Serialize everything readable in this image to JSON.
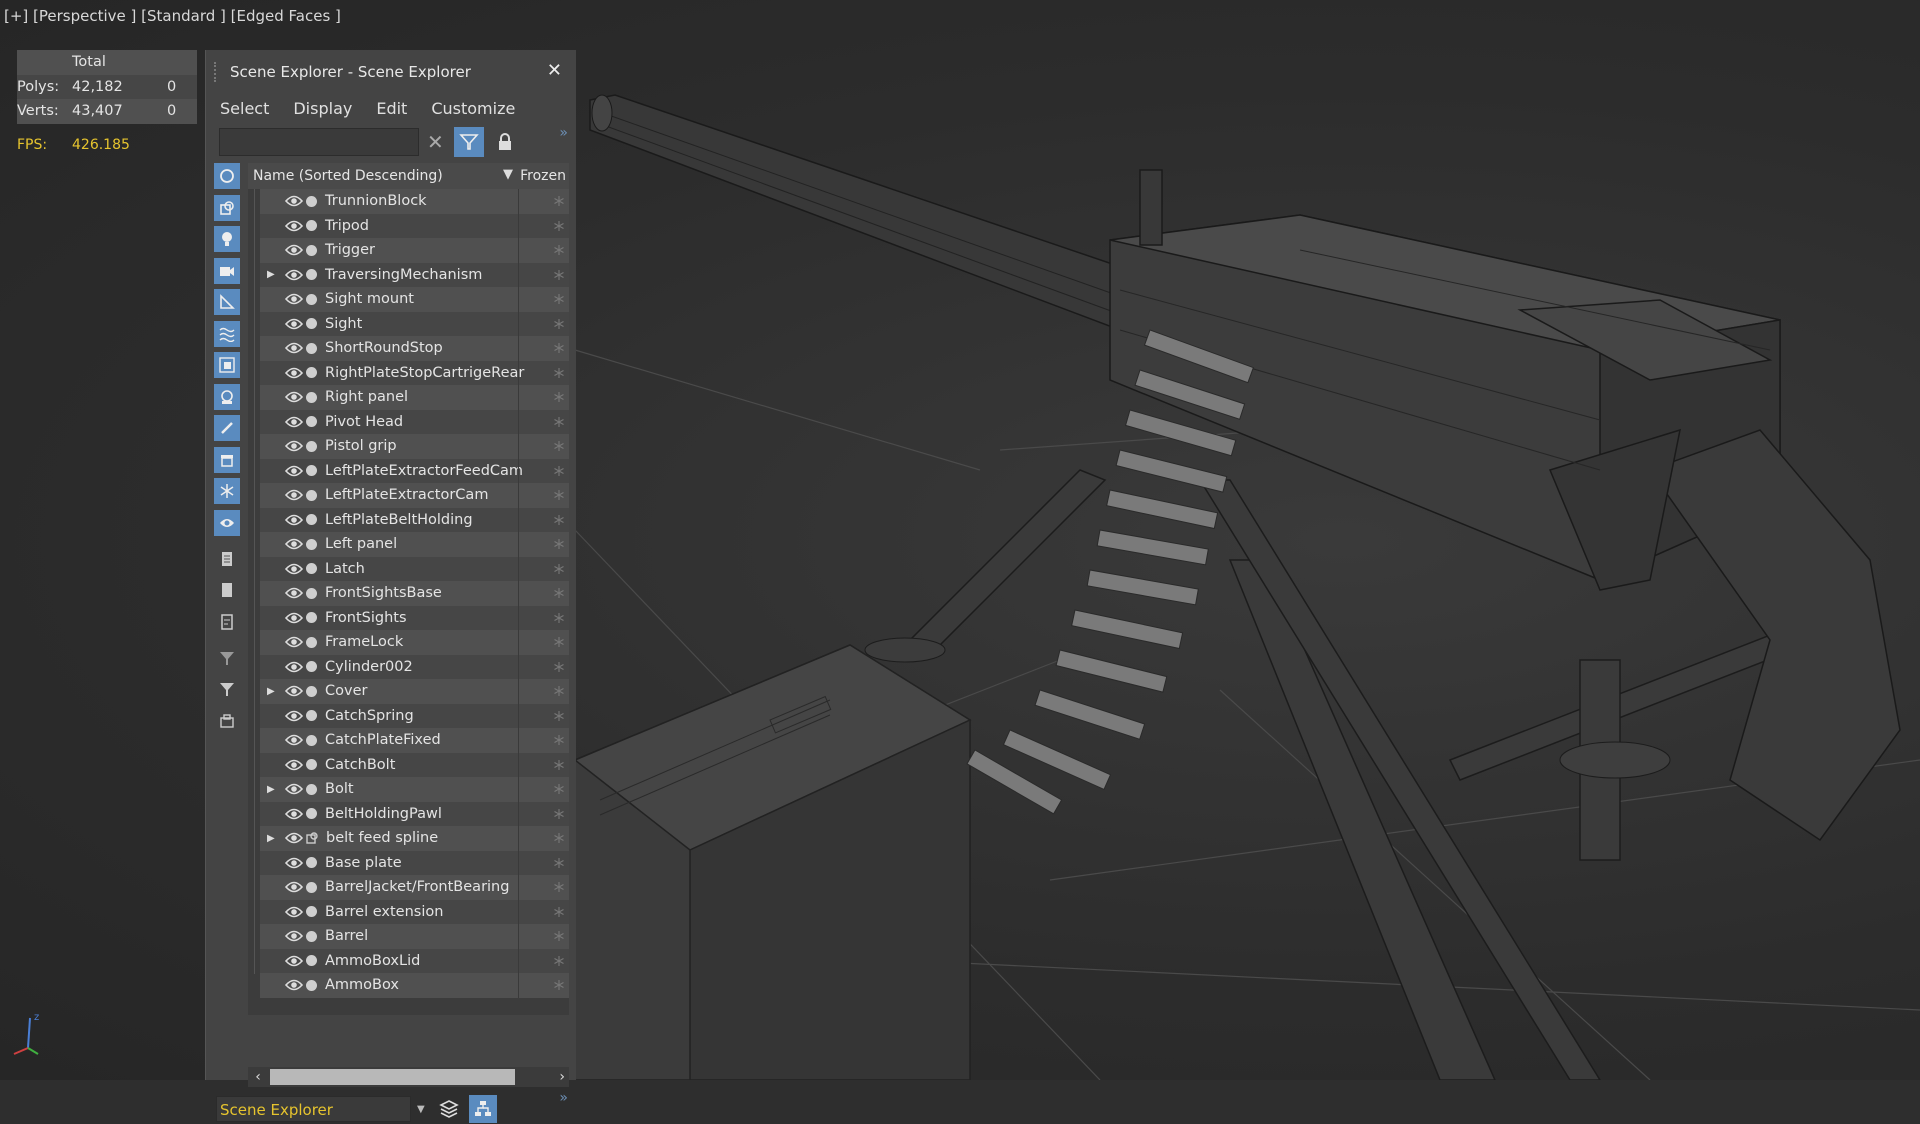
{
  "viewport": {
    "label": "[+] [Perspective ] [Standard ] [Edged Faces ]",
    "stats": {
      "total_label": "Total",
      "polys_label": "Polys:",
      "polys_total": "42,182",
      "polys_sel": "0",
      "verts_label": "Verts:",
      "verts_total": "43,407",
      "verts_sel": "0",
      "fps_label": "FPS:",
      "fps_value": "426.185"
    },
    "axis_label": "z"
  },
  "explorer": {
    "title": "Scene Explorer - Scene Explorer",
    "close": "✕",
    "menu": [
      "Select",
      "Display",
      "Edit",
      "Customize"
    ],
    "search_value": "",
    "column_name": "Name (Sorted Descending)",
    "column_frozen": "Frozen",
    "objects": [
      {
        "name": "TrunnionBlock",
        "expandable": false,
        "type": "mesh"
      },
      {
        "name": "Tripod",
        "expandable": false,
        "type": "mesh"
      },
      {
        "name": "Trigger",
        "expandable": false,
        "type": "mesh"
      },
      {
        "name": "TraversingMechanism",
        "expandable": true,
        "type": "mesh"
      },
      {
        "name": "Sight mount",
        "expandable": false,
        "type": "mesh"
      },
      {
        "name": "Sight",
        "expandable": false,
        "type": "mesh"
      },
      {
        "name": "ShortRoundStop",
        "expandable": false,
        "type": "mesh"
      },
      {
        "name": "RightPlateStopCartrigeRear",
        "expandable": false,
        "type": "mesh"
      },
      {
        "name": "Right panel",
        "expandable": false,
        "type": "mesh"
      },
      {
        "name": "Pivot Head",
        "expandable": false,
        "type": "mesh"
      },
      {
        "name": "Pistol grip",
        "expandable": false,
        "type": "mesh"
      },
      {
        "name": "LeftPlateExtractorFeedCam",
        "expandable": false,
        "type": "mesh"
      },
      {
        "name": "LeftPlateExtractorCam",
        "expandable": false,
        "type": "mesh"
      },
      {
        "name": "LeftPlateBeltHolding",
        "expandable": false,
        "type": "mesh"
      },
      {
        "name": "Left panel",
        "expandable": false,
        "type": "mesh"
      },
      {
        "name": "Latch",
        "expandable": false,
        "type": "mesh"
      },
      {
        "name": "FrontSightsBase",
        "expandable": false,
        "type": "mesh"
      },
      {
        "name": "FrontSights",
        "expandable": false,
        "type": "mesh"
      },
      {
        "name": "FrameLock",
        "expandable": false,
        "type": "mesh"
      },
      {
        "name": "Cylinder002",
        "expandable": false,
        "type": "mesh"
      },
      {
        "name": "Cover",
        "expandable": true,
        "type": "mesh"
      },
      {
        "name": "CatchSpring",
        "expandable": false,
        "type": "mesh"
      },
      {
        "name": "CatchPlateFixed",
        "expandable": false,
        "type": "mesh"
      },
      {
        "name": "CatchBolt",
        "expandable": false,
        "type": "mesh"
      },
      {
        "name": "Bolt",
        "expandable": true,
        "type": "mesh"
      },
      {
        "name": "BeltHoldingPawl",
        "expandable": false,
        "type": "mesh"
      },
      {
        "name": "belt feed spline",
        "expandable": true,
        "type": "shape"
      },
      {
        "name": "Base plate",
        "expandable": false,
        "type": "mesh"
      },
      {
        "name": "BarrelJacket/FrontBearing",
        "expandable": false,
        "type": "mesh"
      },
      {
        "name": "Barrel extension",
        "expandable": false,
        "type": "mesh"
      },
      {
        "name": "Barrel",
        "expandable": false,
        "type": "mesh"
      },
      {
        "name": "AmmoBoxLid",
        "expandable": false,
        "type": "mesh"
      },
      {
        "name": "AmmoBox",
        "expandable": false,
        "type": "mesh"
      }
    ],
    "bottom_select": "Scene Explorer",
    "colors": {
      "accent": "#5a8bbf",
      "stats": "#e6c42e",
      "panel": "#444444"
    }
  }
}
